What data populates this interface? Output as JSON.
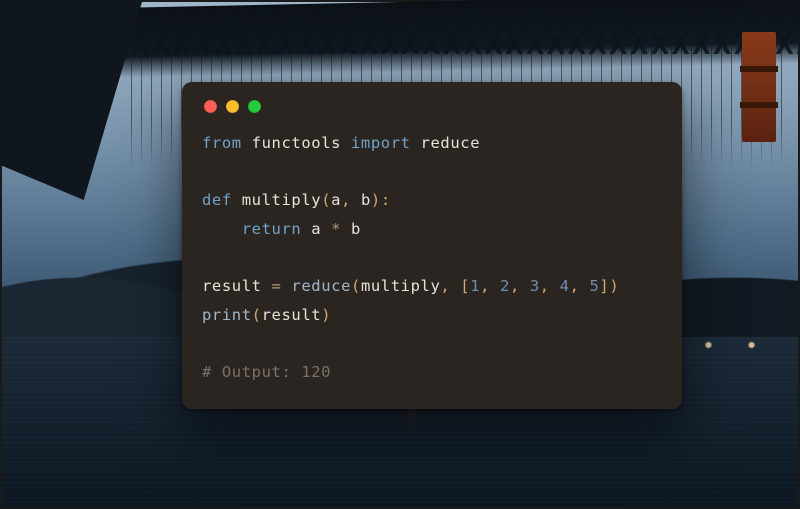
{
  "window": {
    "buttons": {
      "close": "red",
      "minimize": "yellow",
      "zoom": "green"
    }
  },
  "code": {
    "l1": {
      "from": "from",
      "mod": "functools",
      "import": "import",
      "name": "reduce"
    },
    "l3": {
      "def": "def",
      "fn": "multiply",
      "lp": "(",
      "a": "a",
      "c1": ",",
      "sp": " ",
      "b": "b",
      "rp": ")",
      "colon": ":"
    },
    "l4": {
      "ret": "return",
      "a": "a",
      "op": "*",
      "b": "b"
    },
    "l6": {
      "lhs": "result",
      "eq": "=",
      "call": "reduce",
      "lp": "(",
      "arg1": "multiply",
      "c1": ",",
      "lb": "[",
      "n1": "1",
      "c2": ",",
      "n2": "2",
      "c3": ",",
      "n3": "3",
      "c4": ",",
      "n4": "4",
      "c5": ",",
      "n5": "5",
      "rb": "]",
      "rp": ")"
    },
    "l7": {
      "call": "print",
      "lp": "(",
      "arg": "result",
      "rp": ")"
    },
    "l9": {
      "text": "# Output: 120"
    }
  },
  "output_value": 120
}
